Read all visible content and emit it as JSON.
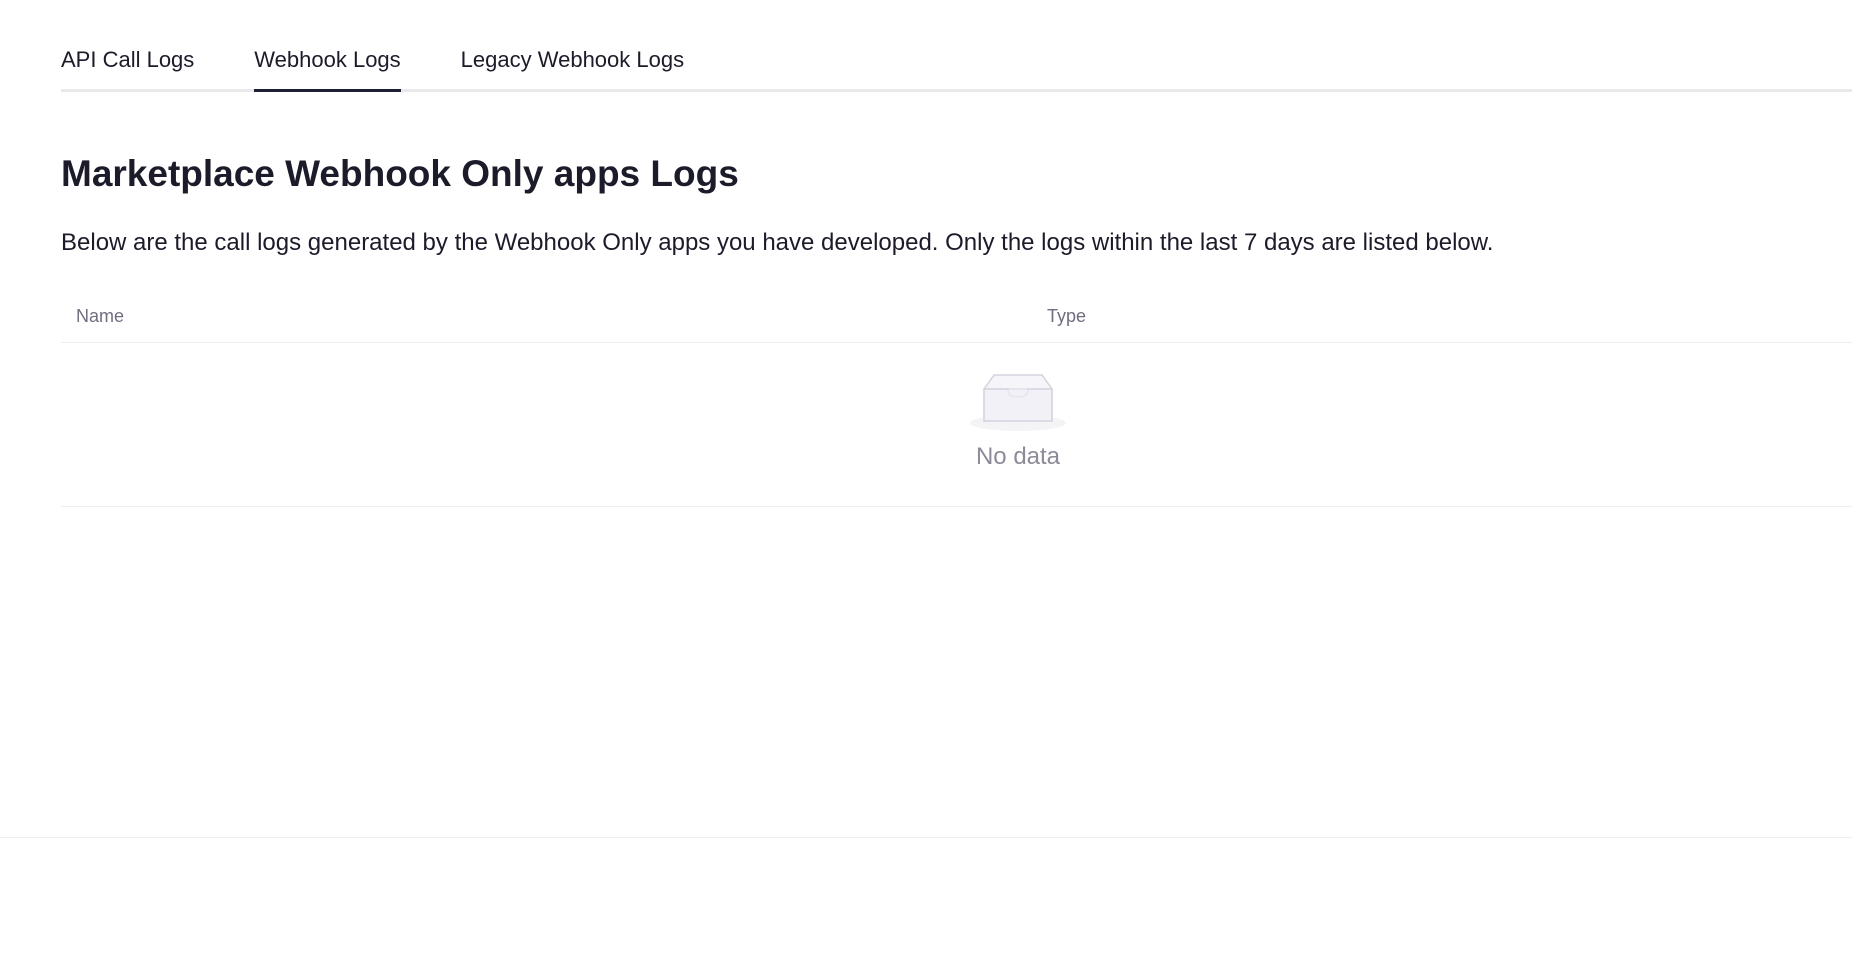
{
  "tabs": [
    {
      "label": "API Call Logs",
      "active": false
    },
    {
      "label": "Webhook Logs",
      "active": true
    },
    {
      "label": "Legacy Webhook Logs",
      "active": false
    }
  ],
  "page": {
    "title": "Marketplace Webhook Only apps Logs",
    "description": "Below are the call logs generated by the Webhook Only apps you have developed. Only the logs within the last 7 days are listed below."
  },
  "table": {
    "columns": [
      "Name",
      "Type"
    ],
    "rows": [],
    "empty_icon": "inbox-icon",
    "empty_text": "No data"
  },
  "colors": {
    "text": "#1b1b2a",
    "active_tab_indicator": "#1e1e38",
    "muted": "#8b8b99",
    "header_text": "#6e6e80"
  }
}
